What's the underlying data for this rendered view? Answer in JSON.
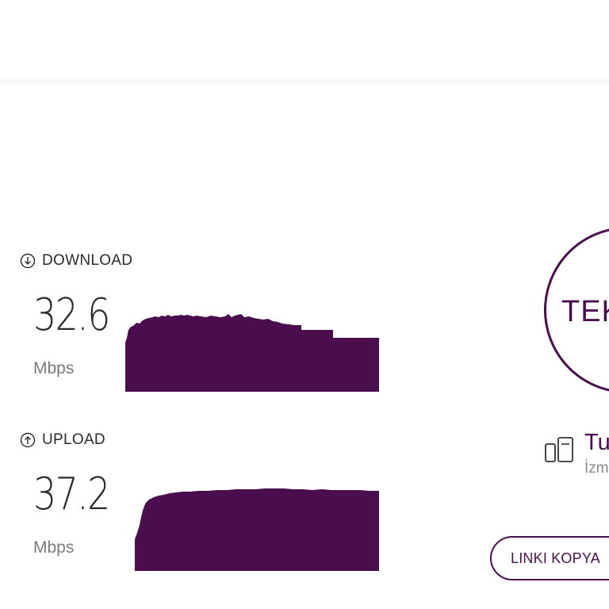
{
  "download": {
    "label": "DOWNLOAD",
    "value": "32.6",
    "unit": "Mbps",
    "icon": "arrow-down-circle-icon"
  },
  "upload": {
    "label": "UPLOAD",
    "value": "37.2",
    "unit": "Mbps",
    "icon": "arrow-up-circle-icon"
  },
  "start_circle": {
    "label": "TEK"
  },
  "server": {
    "name": "Tu",
    "location": "İzm",
    "icon": "server-icon"
  },
  "copy_link_button": {
    "label": "LINKI KOPYA"
  },
  "colors": {
    "accent": "#4a0e4e",
    "text": "#2b2b2b",
    "muted": "#7a7a7a"
  }
}
